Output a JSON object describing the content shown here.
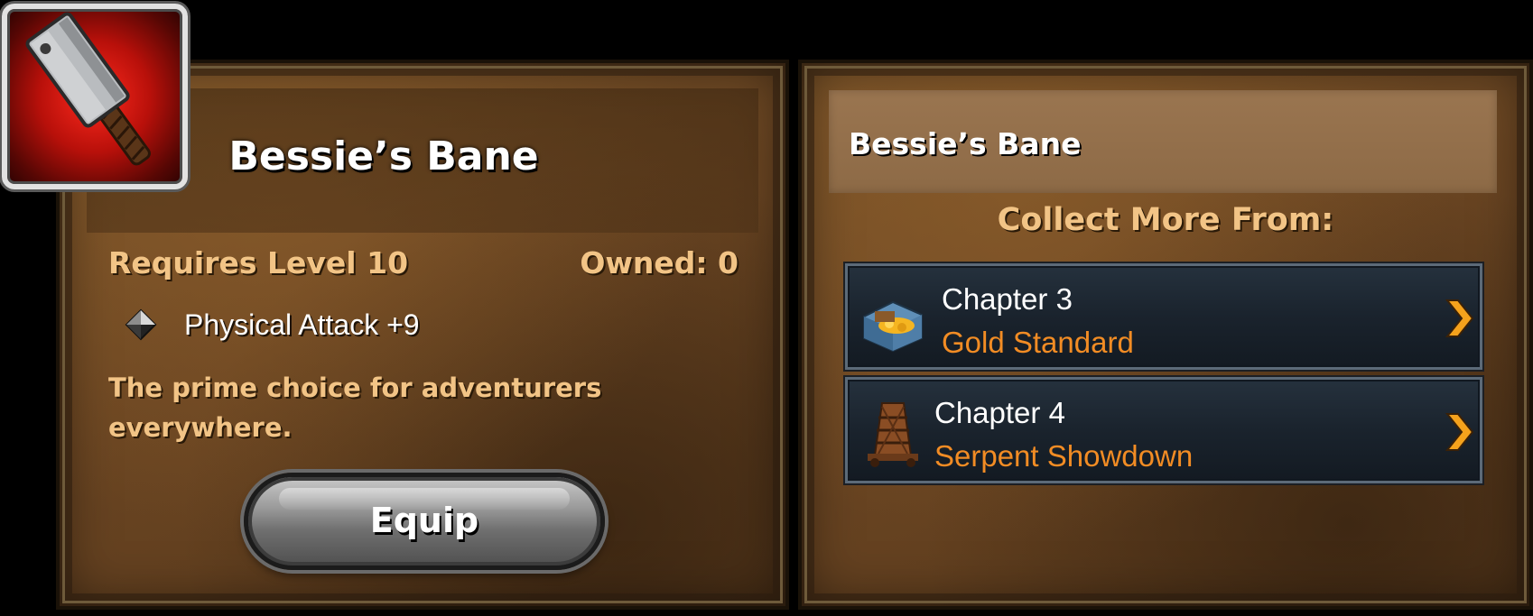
{
  "item": {
    "title": "Bessie’s Bane",
    "icon": "cleaver-icon",
    "requires": "Requires Level 10",
    "owned": "Owned: 0",
    "stat": {
      "icon": "diamond-icon",
      "text": "Physical Attack +9"
    },
    "description": "The prime choice for adventurers everywhere.",
    "equip_label": "Equip"
  },
  "sources": {
    "header_title": "Bessie’s Bane",
    "collect_label": "Collect More From:",
    "items": [
      {
        "chapter": "Chapter 3",
        "name": "Gold Standard",
        "icon": "treasure-chest-icon"
      },
      {
        "chapter": "Chapter 4",
        "name": "Serpent Showdown",
        "icon": "siege-tower-icon"
      }
    ]
  },
  "colors": {
    "label_gold": "#f2c486",
    "chapter_orange": "#f28c24",
    "icon_red": "#c0140c"
  }
}
